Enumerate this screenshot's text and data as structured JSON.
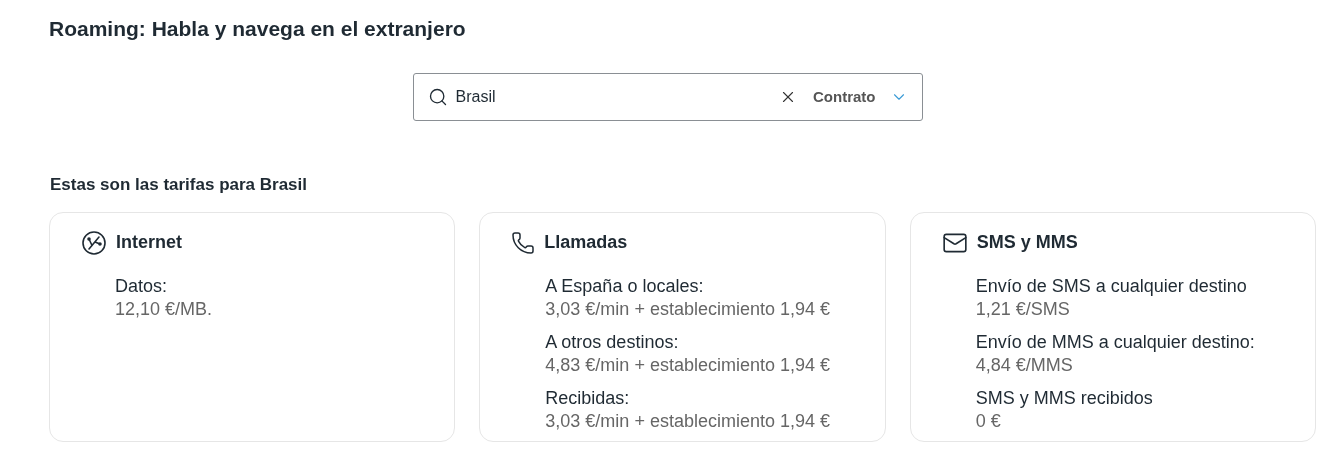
{
  "title": "Roaming: Habla y navega en el extranjero",
  "search": {
    "value": "Brasil",
    "filter": "Contrato"
  },
  "subtitle": "Estas son las tarifas para Brasil",
  "cards": [
    {
      "kind": "internet",
      "title": "Internet",
      "items": [
        {
          "label": "Datos:",
          "value": "12,10 €/MB."
        }
      ]
    },
    {
      "kind": "phone",
      "title": "Llamadas",
      "items": [
        {
          "label": "A España o locales:",
          "value": "3,03 €/min + establecimiento 1,94 €"
        },
        {
          "label": "A otros destinos:",
          "value": "4,83 €/min + establecimiento 1,94 €"
        },
        {
          "label": "Recibidas:",
          "value": "3,03 €/min + establecimiento 1,94 €"
        }
      ]
    },
    {
      "kind": "mail",
      "title": "SMS y MMS",
      "items": [
        {
          "label": "Envío de SMS a cualquier destino",
          "value": "1,21 €/SMS"
        },
        {
          "label": "Envío de MMS a cualquier destino:",
          "value": "4,84 €/MMS"
        },
        {
          "label": "SMS y MMS recibidos",
          "value": "0 €"
        }
      ]
    }
  ]
}
